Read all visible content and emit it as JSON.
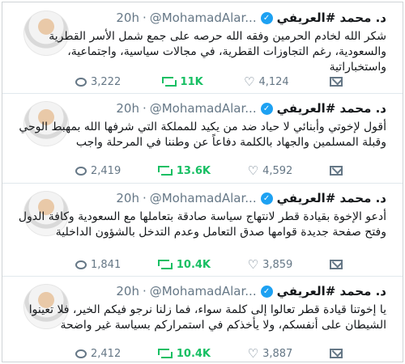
{
  "tweets": [
    {
      "name": "د. محمد #العريفي",
      "handle": "@MohamadAlar...",
      "time": "20h",
      "text": "شكر الله لخادم الحرمين وفقه الله حرصه على جمع شمل الأسر القطرية والسعودية، رغم التجاوزات القطرية، في مجالات سياسية، واجتماعية، واستخباراتية",
      "replies": "3,222",
      "retweets": "11K",
      "likes": "4,124"
    },
    {
      "name": "د. محمد #العريفي",
      "handle": "@MohamadAlar...",
      "time": "20h",
      "text": "أقول لإخوتي وأبنائي لا حياد ضد من يكيد للمملكة التي شرفها الله بمهبط الوحي وقبلة المسلمين والجهاد بالكلمة دفاعاً عن وطننا في المرحلة واجب",
      "replies": "2,419",
      "retweets": "13.6K",
      "likes": "4,592"
    },
    {
      "name": "د. محمد #العريفي",
      "handle": "@MohamadAlar...",
      "time": "20h",
      "text": "أدعو الإخوة بقيادة قطر لانتهاج سياسة صادقة بتعاملها مع السعودية وكافة الدول وفتح صفحة جديدة قوامها صدق التعامل وعدم التدخل بالشؤون الداخلية",
      "replies": "1,841",
      "retweets": "10.4K",
      "likes": "3,859"
    },
    {
      "name": "د. محمد #العريفي",
      "handle": "@MohamadAlar...",
      "time": "20h",
      "text": "يا إخوتنا قيادة قطر تعالوا إلى كلمة سواء، فما زلنا نرجو فيكم الخير، فلا تعينوا الشيطان على أنفسكم، ولا يأخذكم في استمراركم بسياسة غير واضحة",
      "replies": "2,412",
      "retweets": "10.4K",
      "likes": "3,887"
    }
  ],
  "icons": {
    "verified": "verified-badge-icon",
    "reply": "reply-icon",
    "retweet": "retweet-icon",
    "like": "heart-icon",
    "dm": "direct-message-icon"
  },
  "colors": {
    "retweet": "#17bf63",
    "verified": "#1da1f2",
    "muted": "#657786"
  },
  "glyphs": {
    "verified": "✓",
    "heart": "♡",
    "dot": "·"
  }
}
